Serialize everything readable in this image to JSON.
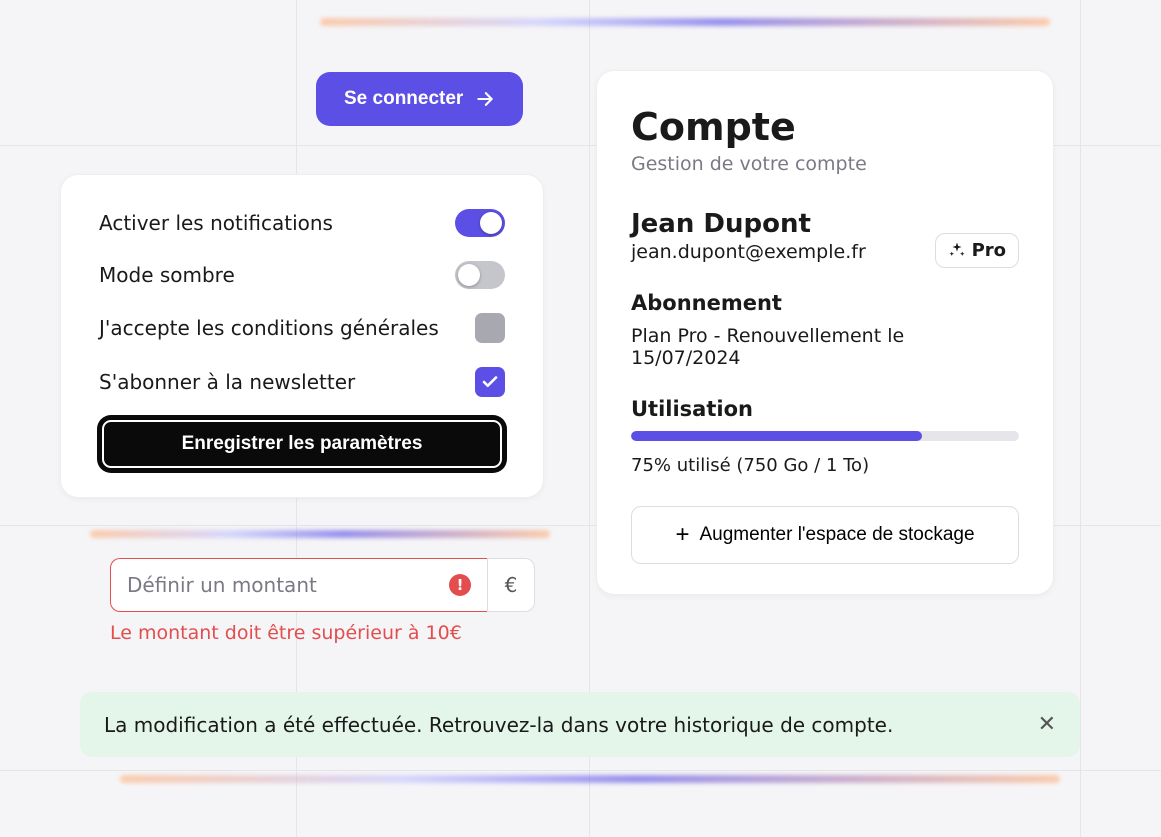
{
  "connect_button": "Se connecter",
  "settings": {
    "notifications_label": "Activer les notifications",
    "dark_mode_label": "Mode sombre",
    "terms_label": "J'accepte les conditions générales",
    "newsletter_label": "S'abonner à la newsletter",
    "save_label": "Enregistrer les paramètres"
  },
  "amount": {
    "placeholder": "Définir un montant",
    "currency": "€",
    "error": "Le montant doit être supérieur à 10€",
    "error_badge": "!"
  },
  "account": {
    "title": "Compte",
    "subtitle": "Gestion de votre compte",
    "name": "Jean Dupont",
    "email": "jean.dupont@exemple.fr",
    "badge": "Pro",
    "sub_heading": "Abonnement",
    "sub_text": "Plan Pro - Renouvellement le 15/07/2024",
    "usage_heading": "Utilisation",
    "usage_text": "75% utilisé (750 Go / 1 To)",
    "upgrade_label": "Augmenter l'espace de stockage"
  },
  "toast": {
    "text": "La modification a été effectuée. Retrouvez-la dans votre historique de compte.",
    "close": "✕"
  }
}
